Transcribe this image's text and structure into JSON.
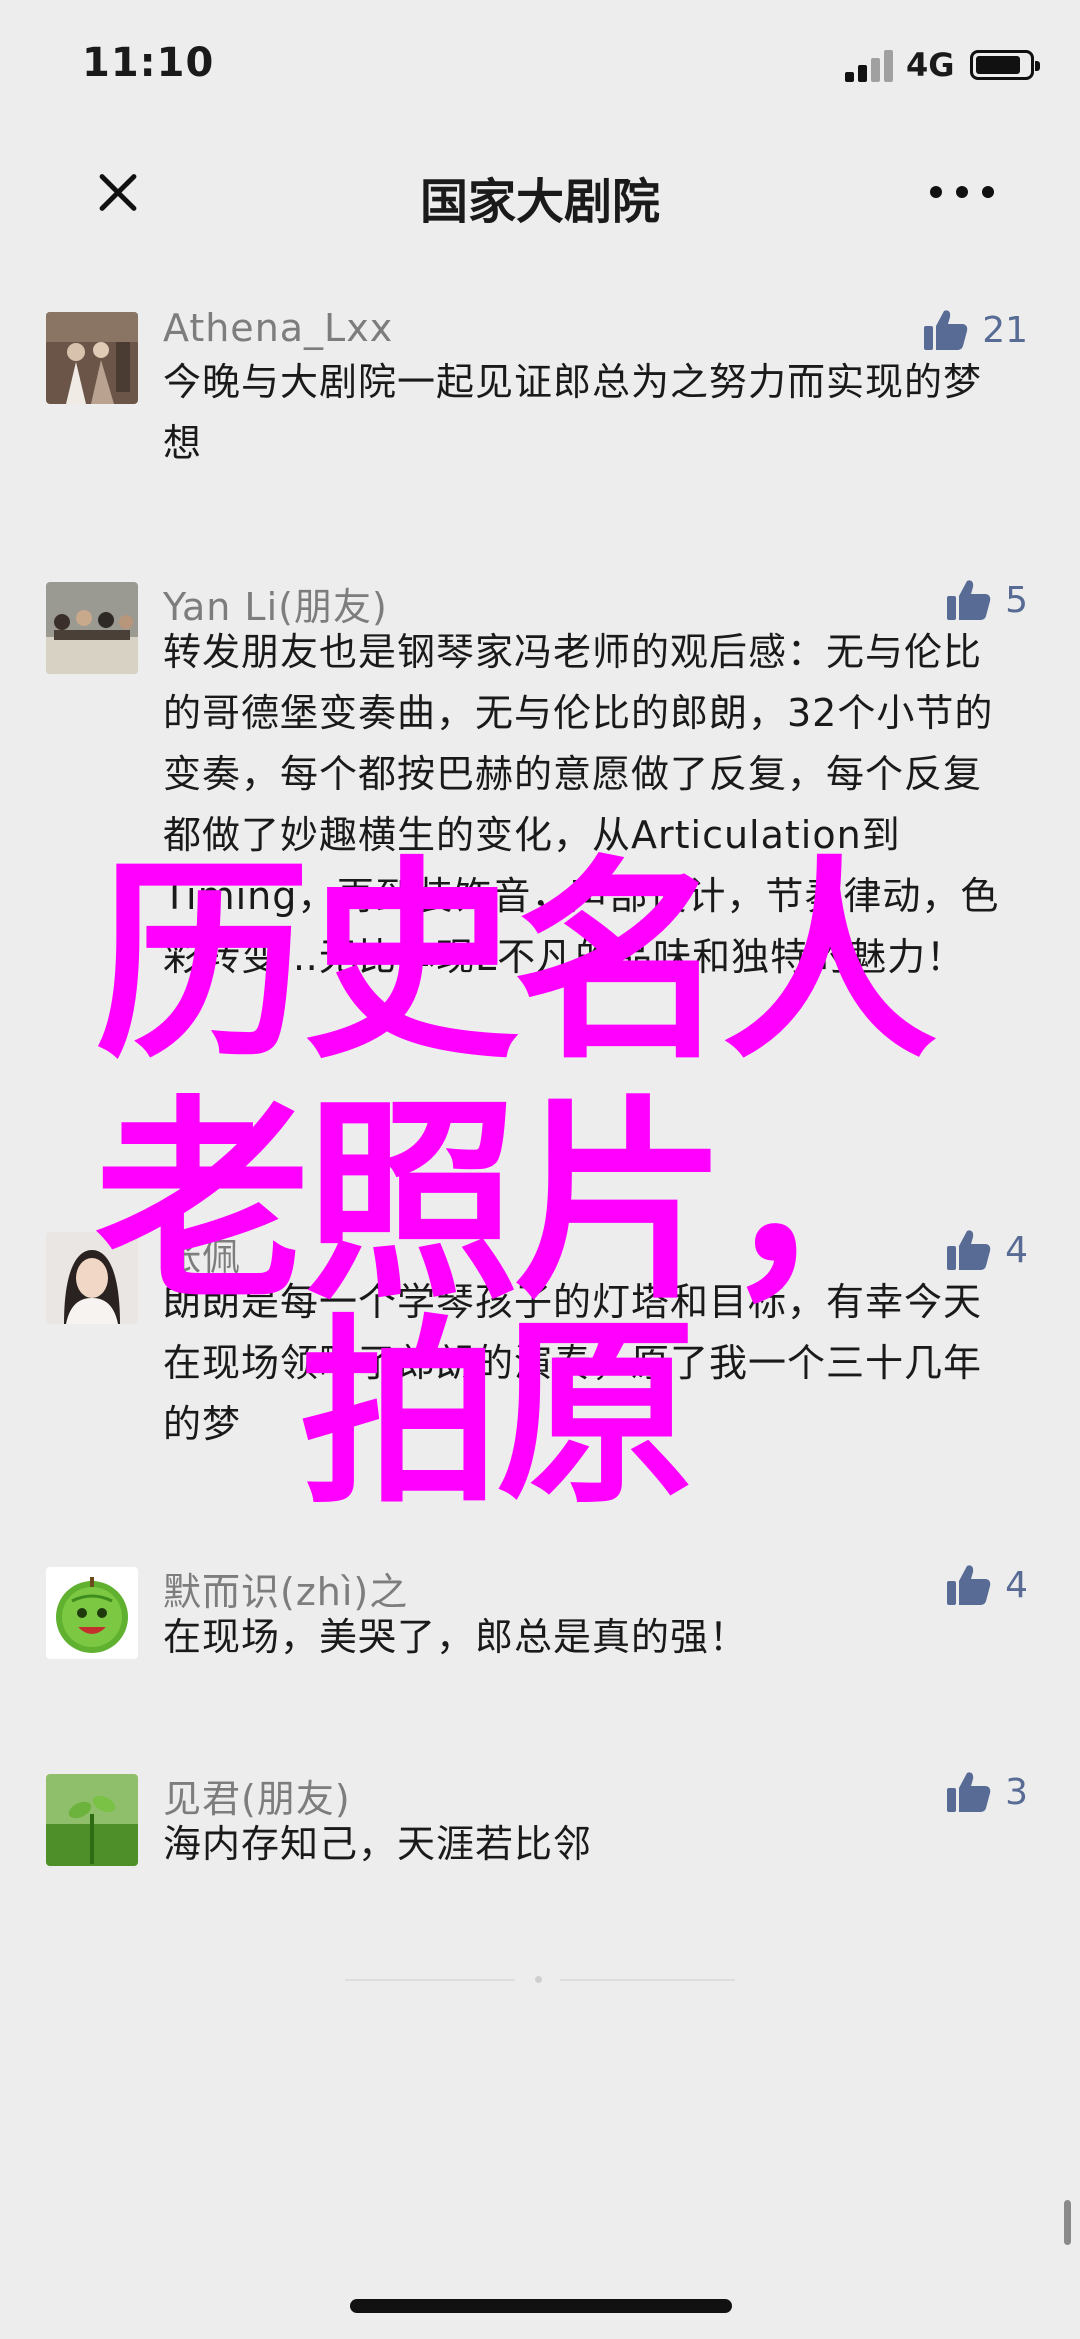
{
  "status": {
    "time": "11:10",
    "network": "4G",
    "battery_level": 0.85
  },
  "nav": {
    "title": "国家大剧院",
    "close_icon": "close-icon",
    "more_icon": "more-icon"
  },
  "comments": [
    {
      "name": "Athena_Lxx",
      "likes": "21",
      "text": "今晚与大剧院一起见证郎总为之努力而实现的梦想"
    },
    {
      "name": "Yan Li(朋友)",
      "likes": "5",
      "text": "转发朋友也是钢琴家冯老师的观后感：无与伦比的哥德堡变奏曲，无与伦比的郎朗，32个小节的变奏，每个都按巴赫的意愿做了反复，每个反复都做了妙趣横生的变化，从Articulation到Timing，再到装饰音，声部设计，节奏律动，色彩转变…无比体现L不凡的品味和独特的魅力！"
    },
    {
      "name": "张佩",
      "likes": "4",
      "text": "朗朗是每一个学琴孩子的灯塔和目标，有幸今天在现场领略了郎朗的演奏，原了我一个三十几年的梦"
    },
    {
      "name": "默而识(zhì)之",
      "likes": "4",
      "text": "在现场，美哭了，郎总是真的强！"
    },
    {
      "name": "见君(朋友)",
      "likes": "3",
      "text": "海内存知己，天涯若比邻"
    }
  ],
  "watermark": {
    "line1": "历史名人",
    "line2": "老照片，",
    "line3": "拍原"
  },
  "colors": {
    "background": "#ededed",
    "name": "#7d7d7d",
    "likes": "#576b95",
    "watermark": "#ff00ff"
  }
}
